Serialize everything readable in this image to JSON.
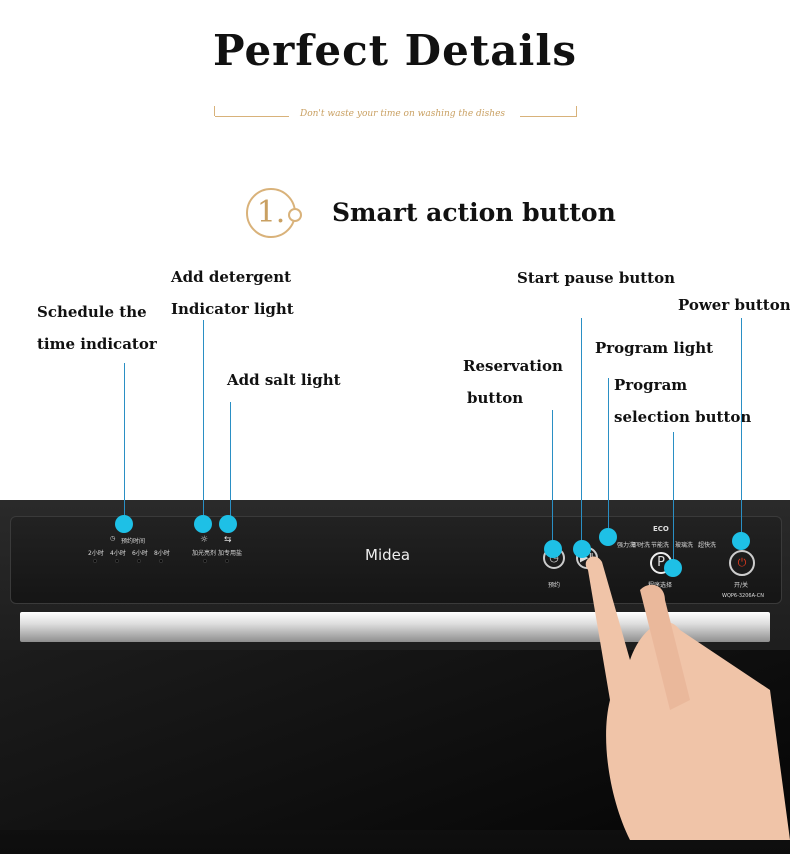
{
  "header": {
    "title": "Perfect Details",
    "subtitle": "Don't waste your time on washing the dishes"
  },
  "section": {
    "number": "1.",
    "title": "Smart action button"
  },
  "callouts": {
    "schedule": [
      "Schedule the",
      "time indicator"
    ],
    "detergent": [
      "Add detergent",
      "Indicator light"
    ],
    "salt": "Add salt light",
    "reservation": [
      "Reservation",
      "button"
    ],
    "start": "Start pause button",
    "program_light": "Program light",
    "program_select": [
      "Program",
      "selection button"
    ],
    "power": "Power button"
  },
  "panel": {
    "brand": "Midea",
    "schedule_title": "预约时间",
    "hours": [
      "2小时",
      "4小时",
      "6小时",
      "8小时"
    ],
    "detergent": "加光亮剂",
    "salt": "加专用盐",
    "programs": [
      "强力洗",
      "即时洗",
      "节能洗",
      "玻璃洗",
      "超快洗"
    ],
    "eco": "ECO",
    "reserve": "预约",
    "program_select": "程序选择",
    "program_btn": "P",
    "power": "开/关",
    "model": "WQP6-3206A-CN"
  },
  "colors": {
    "accent": "#1ec0e6",
    "gold": "#c9a062",
    "power": "#e53a1e"
  }
}
